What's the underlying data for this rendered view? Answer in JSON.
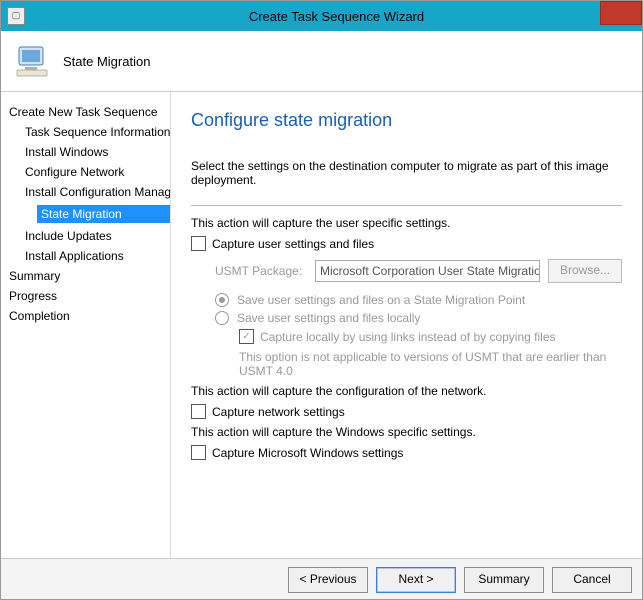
{
  "window": {
    "title": "Create Task Sequence Wizard",
    "close_tooltip": "Close"
  },
  "header": {
    "icon": "monitor-icon",
    "title": "State Migration"
  },
  "sidebar": {
    "root": "Create New Task Sequence",
    "items": [
      "Task Sequence Information",
      "Install Windows",
      "Configure Network",
      "Install Configuration Manager",
      "State Migration",
      "Include Updates",
      "Install Applications"
    ],
    "selected_index": 4,
    "tail": [
      "Summary",
      "Progress",
      "Completion"
    ]
  },
  "content": {
    "heading": "Configure state migration",
    "instruction": "Select the settings on the destination computer to migrate as part of this image deployment.",
    "capture_user": {
      "intro": "This action will capture the user specific settings.",
      "checkbox": "Capture user settings and files",
      "usmt_label": "USMT Package:",
      "usmt_value": "Microsoft Corporation User State Migration Tool",
      "browse": "Browse...",
      "radio1": "Save user settings and files on a State Migration Point",
      "radio2": "Save user settings and files locally",
      "links_checkbox": "Capture locally by using links instead of by copying files",
      "note": "This option is not applicable to versions of USMT that are earlier than USMT 4.0"
    },
    "capture_net": {
      "intro": "This action will capture the configuration of the network.",
      "checkbox": "Capture network settings"
    },
    "capture_win": {
      "intro": "This action will capture the Windows specific settings.",
      "checkbox": "Capture Microsoft Windows settings"
    }
  },
  "footer": {
    "previous": "<  Previous",
    "next": "Next  >",
    "summary": "Summary",
    "cancel": "Cancel"
  }
}
